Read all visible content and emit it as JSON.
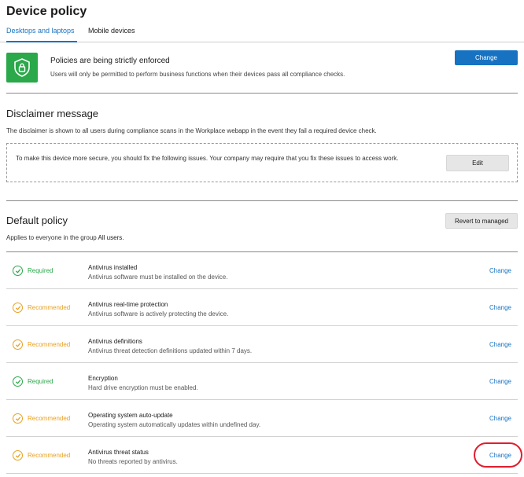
{
  "header": {
    "title": "Device policy"
  },
  "tabs": [
    {
      "label": "Desktops and laptops",
      "active": true
    },
    {
      "label": "Mobile devices",
      "active": false
    }
  ],
  "enforcement": {
    "icon": "shield-lock-icon",
    "title": "Policies are being strictly enforced",
    "description": "Users will only be permitted to perform business functions when their devices pass all compliance checks.",
    "change_label": "Change"
  },
  "disclaimer": {
    "title": "Disclaimer message",
    "description": "The disclaimer is shown to all users during compliance scans in the Workplace webapp in the event they fail a required device check.",
    "message": "To make this device more secure, you should fix the following issues. Your company may require that you fix these issues to access work.",
    "edit_label": "Edit"
  },
  "default_policy": {
    "title": "Default policy",
    "description_prefix": "Applies to everyone in the group ",
    "group": "All users",
    "description_suffix": ".",
    "revert_label": "Revert to managed",
    "rows": [
      {
        "status": "Required",
        "title": "Antivirus installed",
        "description": "Antivirus software must be installed on the device.",
        "action": "Change"
      },
      {
        "status": "Recommended",
        "title": "Antivirus real-time protection",
        "description": "Antivirus software is actively protecting the device.",
        "action": "Change"
      },
      {
        "status": "Recommended",
        "title": "Antivirus definitions",
        "description": "Antivirus threat detection definitions updated within 7 days.",
        "action": "Change"
      },
      {
        "status": "Required",
        "title": "Encryption",
        "description": "Hard drive encryption must be enabled.",
        "action": "Change"
      },
      {
        "status": "Recommended",
        "title": "Operating system auto-update",
        "description": "Operating system automatically updates within undefined day.",
        "action": "Change"
      },
      {
        "status": "Recommended",
        "title": "Antivirus threat status",
        "description": "No threats reported by antivirus.",
        "action": "Change"
      }
    ]
  },
  "colors": {
    "accent": "#1773c2",
    "required": "#2aa84a",
    "recommended": "#e8a020",
    "highlight": "#e01e2e"
  }
}
